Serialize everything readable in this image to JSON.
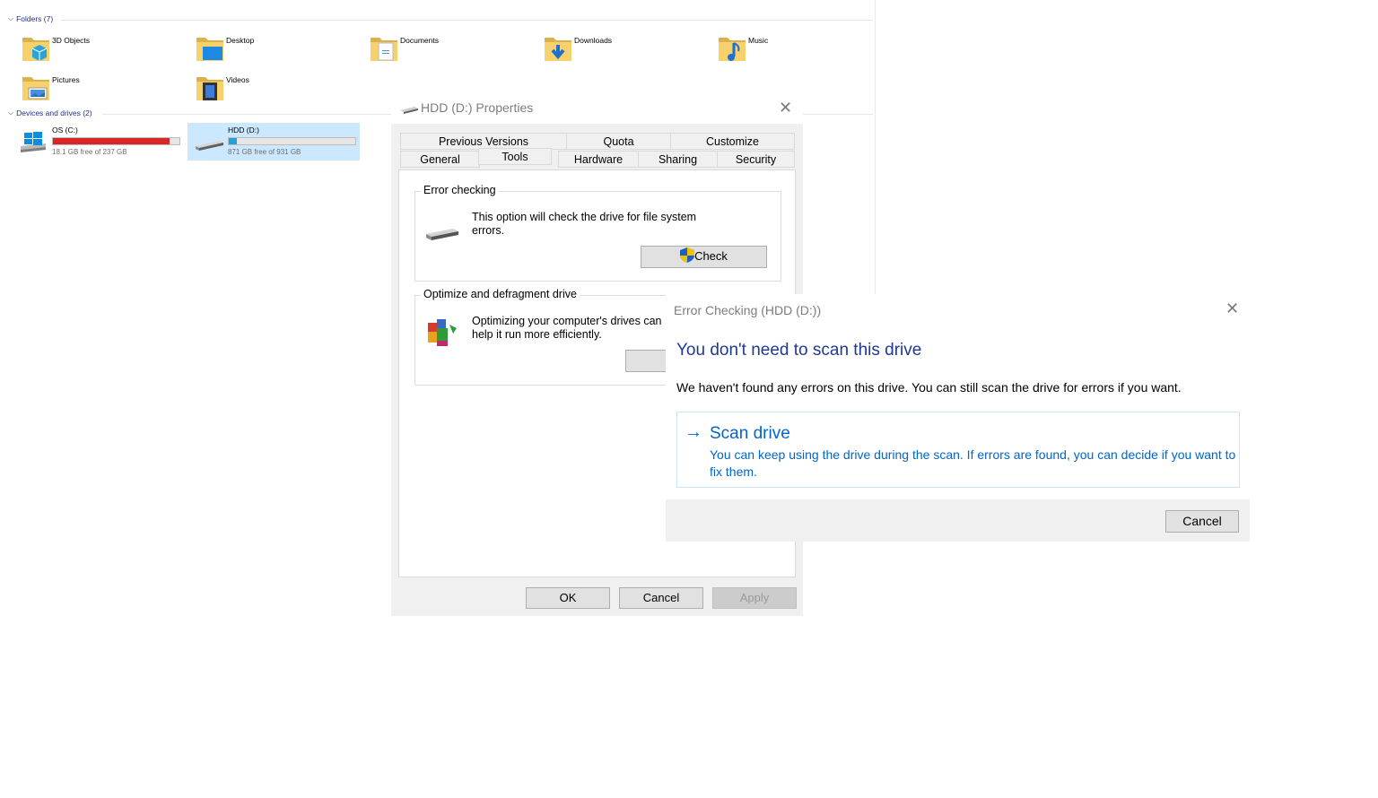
{
  "explorer": {
    "folders_header": "Folders (7)",
    "folders": [
      {
        "label": "3D Objects",
        "icon": "3d-objects-folder-icon"
      },
      {
        "label": "Desktop",
        "icon": "desktop-folder-icon"
      },
      {
        "label": "Documents",
        "icon": "documents-folder-icon"
      },
      {
        "label": "Downloads",
        "icon": "downloads-folder-icon"
      },
      {
        "label": "Music",
        "icon": "music-folder-icon"
      },
      {
        "label": "Pictures",
        "icon": "pictures-folder-icon"
      },
      {
        "label": "Videos",
        "icon": "videos-folder-icon"
      }
    ],
    "drives_header": "Devices and drives (2)",
    "drives": [
      {
        "name": "OS (C:)",
        "free": "18.1 GB free of 237 GB",
        "used_fraction": 0.924,
        "bar_color": "#da2626",
        "icon": "windows-drive-icon"
      },
      {
        "name": "HDD (D:)",
        "free": "871 GB free of 931 GB",
        "used_fraction": 0.064,
        "bar_color": "#26a0da",
        "icon": "hard-drive-icon",
        "selected": true
      }
    ]
  },
  "properties": {
    "title": "HDD (D:) Properties",
    "tabs_row1": [
      "Previous Versions",
      "Quota",
      "Customize"
    ],
    "tabs_row2": [
      "General",
      "Tools",
      "Hardware",
      "Sharing",
      "Security"
    ],
    "active_tab": "Tools",
    "error_checking": {
      "legend": "Error checking",
      "description": "This option will check the drive for file system errors.",
      "button": "Check"
    },
    "optimize": {
      "legend": "Optimize and defragment drive",
      "description": "Optimizing your computer's drives can help it run more efficiently."
    },
    "buttons": {
      "ok": "OK",
      "cancel": "Cancel",
      "apply": "Apply"
    }
  },
  "error_dialog": {
    "title": "Error Checking (HDD (D:))",
    "heading": "You don't need to scan this drive",
    "body": "We haven't found any errors on this drive. You can still scan the drive for errors if you want.",
    "scan_title": "Scan drive",
    "scan_desc": "You can keep using the drive during the scan. If errors are found, you can decide if you want to fix them.",
    "cancel": "Cancel",
    "accent": "#0066cc"
  }
}
